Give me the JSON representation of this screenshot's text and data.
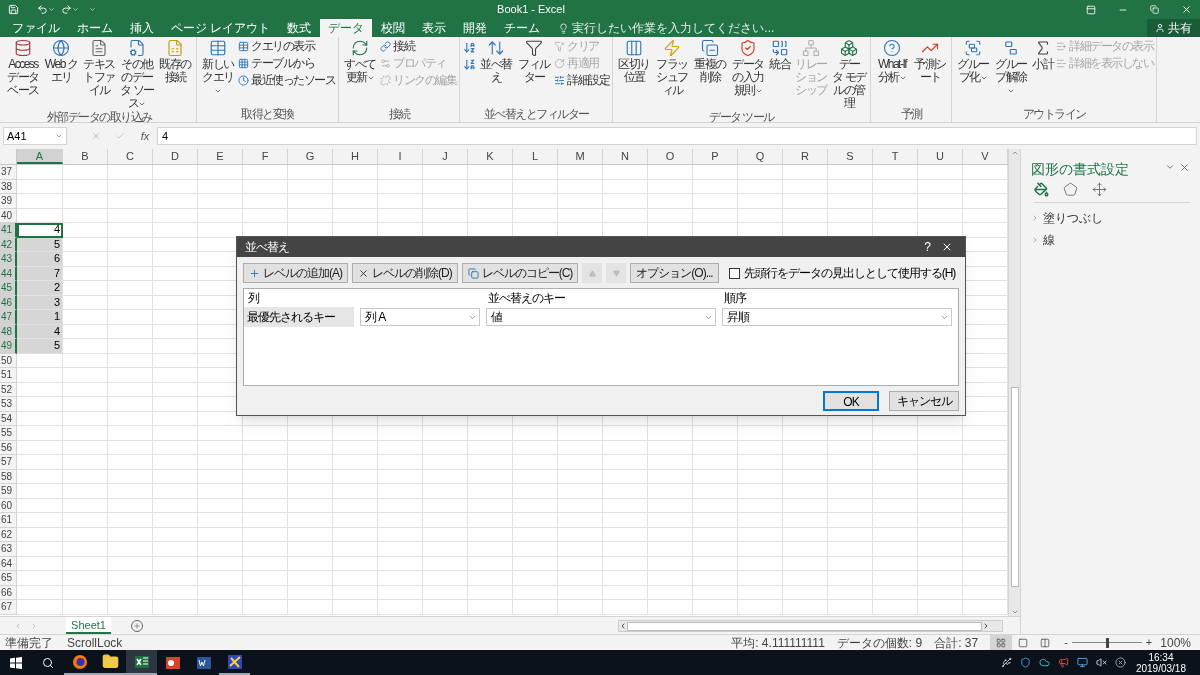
{
  "window": {
    "title": "Book1 - Excel"
  },
  "ribbon_tabs": [
    {
      "label": "ファイル",
      "selected": false
    },
    {
      "label": "ホーム",
      "selected": false
    },
    {
      "label": "挿入",
      "selected": false
    },
    {
      "label": "ページ レイアウト",
      "selected": false
    },
    {
      "label": "数式",
      "selected": false
    },
    {
      "label": "データ",
      "selected": true
    },
    {
      "label": "校閲",
      "selected": false
    },
    {
      "label": "表示",
      "selected": false
    },
    {
      "label": "開発",
      "selected": false
    },
    {
      "label": "チーム",
      "selected": false
    }
  ],
  "tell_me": {
    "placeholder": "実行したい作業を入力してください..."
  },
  "share_button": {
    "label": "共有"
  },
  "ribbon_groups": [
    {
      "label": "外部データの取り込み",
      "items": [
        {
          "kind": "large",
          "label": "Access データベース",
          "menu": false,
          "disabled": false
        },
        {
          "kind": "large",
          "label": "Web クエリ",
          "menu": false,
          "disabled": false
        },
        {
          "kind": "large",
          "label": "テキストファイル",
          "menu": false,
          "disabled": false
        },
        {
          "kind": "large",
          "label": "その他のデータ ソース",
          "menu": true,
          "disabled": false
        },
        {
          "kind": "large",
          "label": "既存の接続",
          "menu": false,
          "disabled": false
        }
      ]
    },
    {
      "label": "取得と変換",
      "items": [
        {
          "kind": "large",
          "label": "新しいクエリ",
          "menu": true,
          "disabled": false
        },
        {
          "kind": "stack",
          "items": [
            {
              "label": "クエリの表示",
              "disabled": false
            },
            {
              "label": "テーブルから",
              "disabled": false
            },
            {
              "label": "最近使ったソース",
              "disabled": false
            }
          ]
        }
      ]
    },
    {
      "label": "接続",
      "items": [
        {
          "kind": "large",
          "label": "すべて更新",
          "menu": true,
          "disabled": false
        },
        {
          "kind": "stack",
          "items": [
            {
              "label": "接続",
              "disabled": false
            },
            {
              "label": "プロパティ",
              "disabled": true
            },
            {
              "label": "リンクの編集",
              "disabled": true
            }
          ]
        }
      ]
    },
    {
      "label": "並べ替えとフィルター",
      "items": [
        {
          "kind": "sort_pair"
        },
        {
          "kind": "large",
          "label": "並べ替え",
          "menu": false,
          "disabled": false
        },
        {
          "kind": "large",
          "label": "フィルター",
          "menu": false,
          "disabled": false
        },
        {
          "kind": "stack",
          "items": [
            {
              "label": "クリア",
              "disabled": true
            },
            {
              "label": "再適用",
              "disabled": true
            },
            {
              "label": "詳細設定",
              "disabled": false
            }
          ]
        }
      ]
    },
    {
      "label": "データ ツール",
      "items": [
        {
          "kind": "large",
          "label": "区切り位置",
          "menu": false,
          "disabled": false
        },
        {
          "kind": "large",
          "label": "フラッシュフィル",
          "menu": false,
          "disabled": false
        },
        {
          "kind": "large",
          "label": "重複の削除",
          "menu": false,
          "disabled": false
        },
        {
          "kind": "large",
          "label": "データの入力規則",
          "menu": true,
          "disabled": false
        },
        {
          "kind": "large",
          "label": "統合",
          "menu": false,
          "disabled": false
        },
        {
          "kind": "large",
          "label": "リレーションシップ",
          "menu": false,
          "disabled": true
        },
        {
          "kind": "large",
          "label": "データ モデルの管理",
          "menu": false,
          "disabled": false
        }
      ]
    },
    {
      "label": "予測",
      "items": [
        {
          "kind": "large",
          "label": "What-If 分析",
          "menu": true,
          "disabled": false
        },
        {
          "kind": "large",
          "label": "予測シート",
          "menu": false,
          "disabled": false
        }
      ]
    },
    {
      "label": "アウトライン",
      "items": [
        {
          "kind": "large",
          "label": "グループ化",
          "menu": true,
          "disabled": false
        },
        {
          "kind": "large",
          "label": "グループ解除",
          "menu": true,
          "disabled": false
        },
        {
          "kind": "large",
          "label": "小計",
          "menu": false,
          "disabled": false
        },
        {
          "kind": "stack",
          "items": [
            {
              "label": "詳細データの表示",
              "disabled": true
            },
            {
              "label": "詳細を表示しない",
              "disabled": true
            }
          ]
        }
      ]
    }
  ],
  "formula_bar": {
    "name_box": "A41",
    "function_label": "fx",
    "value": "4"
  },
  "sheet": {
    "columns": [
      {
        "label": "A",
        "selected": true
      },
      {
        "label": "B",
        "selected": false
      },
      {
        "label": "C",
        "selected": false
      },
      {
        "label": "D",
        "selected": false
      },
      {
        "label": "E",
        "selected": false
      },
      {
        "label": "F",
        "selected": false
      },
      {
        "label": "G",
        "selected": false
      },
      {
        "label": "H",
        "selected": false
      },
      {
        "label": "I",
        "selected": false
      },
      {
        "label": "J",
        "selected": false
      },
      {
        "label": "K",
        "selected": false
      },
      {
        "label": "L",
        "selected": false
      },
      {
        "label": "M",
        "selected": false
      },
      {
        "label": "N",
        "selected": false
      },
      {
        "label": "O",
        "selected": false
      },
      {
        "label": "P",
        "selected": false
      },
      {
        "label": "Q",
        "selected": false
      },
      {
        "label": "R",
        "selected": false
      },
      {
        "label": "S",
        "selected": false
      },
      {
        "label": "T",
        "selected": false
      },
      {
        "label": "U",
        "selected": false
      },
      {
        "label": "V",
        "selected": false
      }
    ],
    "rows": [
      {
        "label": "37",
        "selected": false,
        "active": false
      },
      {
        "label": "38",
        "selected": false,
        "active": false
      },
      {
        "label": "39",
        "selected": false,
        "active": false
      },
      {
        "label": "40",
        "selected": false,
        "active": false
      },
      {
        "label": "41",
        "selected": true,
        "active": true,
        "value": "4"
      },
      {
        "label": "42",
        "selected": true,
        "active": false,
        "value": "5"
      },
      {
        "label": "43",
        "selected": true,
        "active": false,
        "value": "6"
      },
      {
        "label": "44",
        "selected": true,
        "active": false,
        "value": "7"
      },
      {
        "label": "45",
        "selected": true,
        "active": false,
        "value": "2"
      },
      {
        "label": "46",
        "selected": true,
        "active": false,
        "value": "3"
      },
      {
        "label": "47",
        "selected": true,
        "active": false,
        "value": "1"
      },
      {
        "label": "48",
        "selected": true,
        "active": false,
        "value": "4"
      },
      {
        "label": "49",
        "selected": true,
        "active": false,
        "value": "5"
      },
      {
        "label": "50",
        "selected": false,
        "active": false
      },
      {
        "label": "51",
        "selected": false,
        "active": false
      },
      {
        "label": "52",
        "selected": false,
        "active": false
      },
      {
        "label": "53",
        "selected": false,
        "active": false
      },
      {
        "label": "54",
        "selected": false,
        "active": false
      },
      {
        "label": "55",
        "selected": false,
        "active": false
      },
      {
        "label": "56",
        "selected": false,
        "active": false
      },
      {
        "label": "57",
        "selected": false,
        "active": false
      },
      {
        "label": "58",
        "selected": false,
        "active": false
      },
      {
        "label": "59",
        "selected": false,
        "active": false
      },
      {
        "label": "60",
        "selected": false,
        "active": false
      },
      {
        "label": "61",
        "selected": false,
        "active": false
      },
      {
        "label": "62",
        "selected": false,
        "active": false
      },
      {
        "label": "63",
        "selected": false,
        "active": false
      },
      {
        "label": "64",
        "selected": false,
        "active": false
      },
      {
        "label": "65",
        "selected": false,
        "active": false
      },
      {
        "label": "66",
        "selected": false,
        "active": false
      },
      {
        "label": "67",
        "selected": false,
        "active": false
      }
    ]
  },
  "sheet_tabs": [
    {
      "label": "Sheet1",
      "selected": true
    }
  ],
  "side_pane": {
    "title": "図形の書式設定",
    "icon_tabs": [
      {
        "kind": "fill",
        "selected": true
      },
      {
        "kind": "effects",
        "selected": false
      },
      {
        "kind": "size",
        "selected": false
      }
    ],
    "sections": [
      {
        "label": "塗りつぶし",
        "expanded": false
      },
      {
        "label": "線",
        "expanded": false
      }
    ]
  },
  "sort_dialog": {
    "title": "並べ替え",
    "help": "?",
    "toolbar": [
      {
        "kind": "add",
        "label": "レベルの追加(A)",
        "disabled": false
      },
      {
        "kind": "delete",
        "label": "レベルの削除(D)",
        "disabled": false
      },
      {
        "kind": "copy",
        "label": "レベルのコピー(C)",
        "disabled": false
      },
      {
        "kind": "up",
        "disabled": true
      },
      {
        "kind": "down",
        "disabled": true
      },
      {
        "kind": "options",
        "label": "オプション(O)...",
        "disabled": false
      }
    ],
    "header_checkbox": {
      "label": "先頭行をデータの見出しとして使用する(H)",
      "checked": false
    },
    "headers": [
      "列",
      "並べ替えのキー",
      "順序"
    ],
    "levels": [
      {
        "label": "最優先されるキー",
        "column": "列 A",
        "key": "値",
        "order": "昇順"
      }
    ],
    "ok": "OK",
    "cancel": "キャンセル"
  },
  "status_bar": {
    "left": [
      "準備完了",
      "ScrollLock"
    ],
    "stats": [
      "平均: 4.111111111",
      "データの個数: 9",
      "合計: 37"
    ],
    "views": [
      {
        "kind": "normal",
        "selected": true
      },
      {
        "kind": "page_layout",
        "selected": false
      },
      {
        "kind": "page_break",
        "selected": false
      }
    ],
    "zoom": {
      "minus": "-",
      "plus": "+",
      "level": 0.5,
      "reading": "100%"
    }
  },
  "taskbar": {
    "apps": [
      {
        "kind": "browser",
        "active": false,
        "running": true
      },
      {
        "kind": "folder",
        "active": false,
        "running": true
      },
      {
        "kind": "spreadsheet",
        "active": true,
        "running": true
      },
      {
        "kind": "slides",
        "active": false,
        "running": false
      },
      {
        "kind": "document",
        "active": false,
        "running": false
      },
      {
        "kind": "app",
        "active": false,
        "running": true
      }
    ],
    "time": "16:34",
    "date": "2019/03/18"
  }
}
